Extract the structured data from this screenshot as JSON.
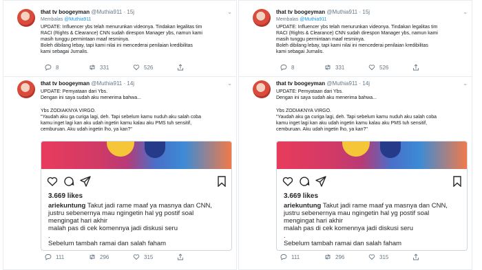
{
  "colors": {
    "link": "#1b95e0",
    "muted": "#657786",
    "border": "#e6ecf0"
  },
  "tweet1": {
    "name": "that tv boogeyman",
    "handle": "@Muthia911",
    "time": "· 15j",
    "replying_prefix": "Membalas",
    "replying_to": "@Muthia911",
    "lines": [
      "UPDATE: Influencer ybs telah menurunkan videonya. Tindakan legalitas tim",
      "RACI (Rights & Clearance) CNN sudah direspon Manager ybs, namun kami",
      "masih tunggu permintaan maaf resminya.",
      "Boleh dibilang lebay, tapi kami nilai ini mencederai penilaian kredibilitas",
      "kami sebagai Jurnalis."
    ],
    "reply_count": "8",
    "retweet_count": "331",
    "like_count": "526"
  },
  "tweet2": {
    "name": "that tv boogeyman",
    "handle": "@Muthia911",
    "time": "· 14j",
    "lines_a": [
      "UPDATE: Pernyataan dari Ybs.",
      "Dengan ini saya sudah aku menerima bahwa..."
    ],
    "lines_b": [
      "Ybs ZODIAKNYA VIRGO.",
      "\"Yaudah aku ga curiga lagi, deh. Tapi sebelum kamu nuduh aku salah coba",
      "kamu inget lagi kan aku udah ingetin kamu kalau aku PMS tuh sensitif,",
      "cemburuan. Aku udah ingetin lho, ya kan?\""
    ],
    "ig": {
      "likes": "3.669 likes",
      "user": "ariekuntung",
      "caption_first": "Takut jadi rame maaf ya masnya dan CNN,",
      "caption_rest": [
        "justru sebenernya mau ngingetin hal yg postif soal",
        "mengingat hari akhir",
        "malah pas di cek komennya jadi diskusi seru",
        ".",
        "Sebelum tambah ramai dan salah faham"
      ]
    },
    "reply_count": "111",
    "retweet_count": "296",
    "like_count": "315"
  }
}
